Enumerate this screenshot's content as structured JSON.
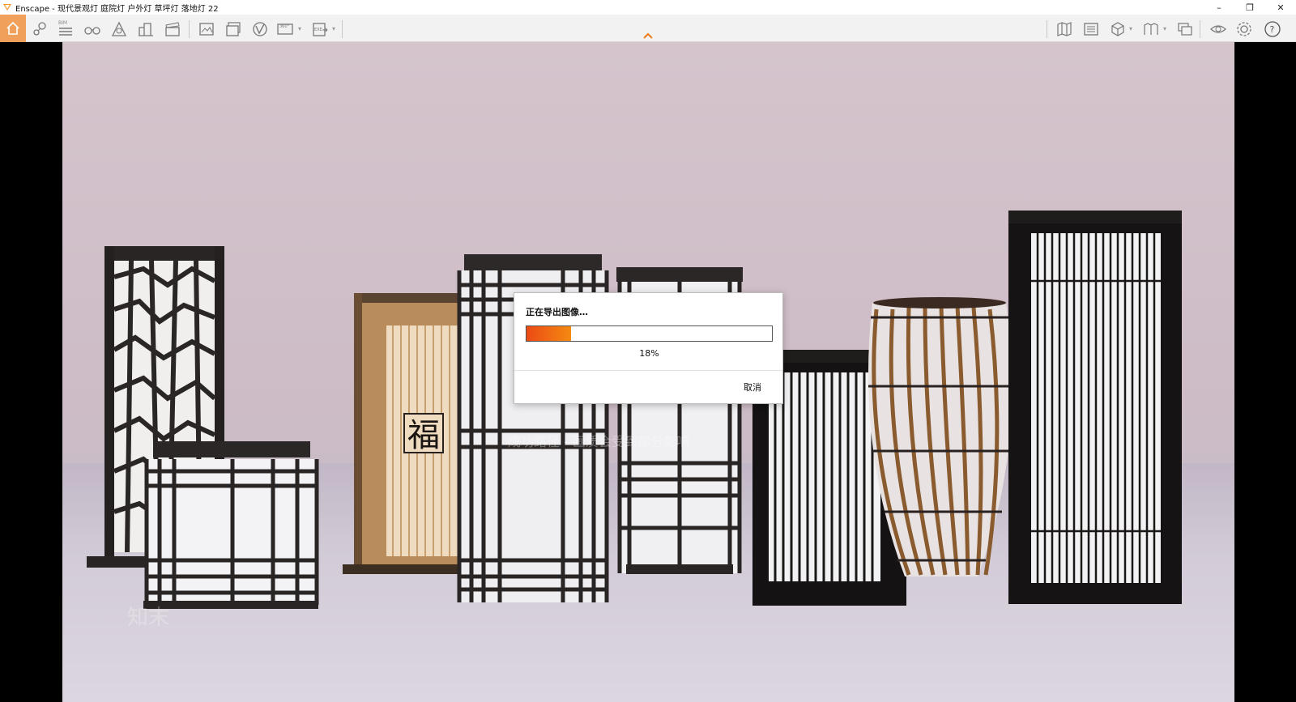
{
  "window": {
    "title": "Enscape - 现代景观灯 庭院灯 户外灯 草坪灯 落地灯  22",
    "controls": {
      "minimize": "–",
      "restore": "❐",
      "close": "✕"
    }
  },
  "toolbar": {
    "left_icons": [
      "home-icon",
      "location-pin-icon",
      "bim-icon",
      "binoculars-icon",
      "asset-library-icon",
      "buildings-icon",
      "clapper-icon",
      "screenshot-icon",
      "batch-render-icon",
      "panorama-vr-icon",
      "render-360-icon",
      "export-exe-icon"
    ],
    "right_icons": [
      "map-icon",
      "visual-settings-icon",
      "cube-view-icon",
      "views-icon",
      "feedback-icon",
      "eye-icon",
      "settings-icon",
      "help-icon"
    ],
    "bim_label": "BIM",
    "vr_label": "360°",
    "exe_label": "EXE",
    "help_label": "?"
  },
  "colors": {
    "accent": "#f0a05a",
    "progress_start": "#ec4a14",
    "progress_end": "#f48a12"
  },
  "dialog": {
    "title": "正在导出图像…",
    "progress_fraction": 0.18,
    "progress_text": "18%",
    "cancel_label": "取消"
  },
  "scene": {
    "fu_character": "福",
    "watermark_tagline": "成功路径 - 画质会受到部分影响",
    "watermark_text": "知末"
  }
}
